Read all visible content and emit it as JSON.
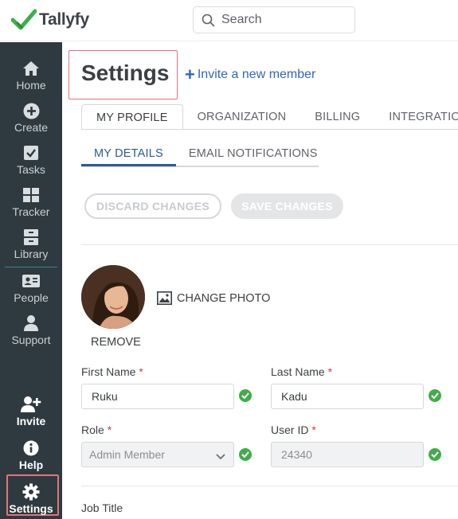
{
  "app": {
    "logo_text": "Tallyfy",
    "search_placeholder": "Search"
  },
  "sidebar": {
    "items": [
      {
        "label": "Home",
        "icon": "home-icon"
      },
      {
        "label": "Create",
        "icon": "plus-circle-icon"
      },
      {
        "label": "Tasks",
        "icon": "checkbox-icon"
      },
      {
        "label": "Tracker",
        "icon": "grid-icon"
      },
      {
        "label": "Library",
        "icon": "archive-icon"
      },
      {
        "label": "People",
        "icon": "id-card-icon"
      },
      {
        "label": "Support",
        "icon": "user-icon"
      }
    ],
    "bottom_items": [
      {
        "label": "Invite",
        "icon": "add-user-icon"
      },
      {
        "label": "Help",
        "icon": "info-icon"
      },
      {
        "label": "Settings",
        "icon": "gear-icon"
      }
    ]
  },
  "page": {
    "title": "Settings",
    "invite_link": "Invite a new member"
  },
  "tabs": [
    {
      "label": "MY PROFILE",
      "active": true
    },
    {
      "label": "ORGANIZATION",
      "active": false
    },
    {
      "label": "BILLING",
      "active": false
    },
    {
      "label": "INTEGRATIONS",
      "active": false
    }
  ],
  "subtabs": [
    {
      "label": "MY DETAILS",
      "active": true
    },
    {
      "label": "EMAIL NOTIFICATIONS",
      "active": false
    }
  ],
  "actions": {
    "discard_label": "DISCARD CHANGES",
    "save_label": "SAVE CHANGES"
  },
  "photo": {
    "change_label": "CHANGE PHOTO",
    "remove_label": "REMOVE"
  },
  "form": {
    "first_name": {
      "label": "First Name",
      "value": "Ruku",
      "required_mark": "*"
    },
    "last_name": {
      "label": "Last Name",
      "value": "Kadu",
      "required_mark": "*"
    },
    "role": {
      "label": "Role",
      "value": "Admin Member",
      "required_mark": "*"
    },
    "user_id": {
      "label": "User ID",
      "value": "24340",
      "required_mark": "*"
    },
    "job_title": {
      "label": "Job Title"
    }
  },
  "colors": {
    "sidebar_bg": "#2f3a40",
    "accent_blue": "#2a5a9c",
    "link_blue": "#3166c6",
    "highlight_red": "#e2737a",
    "success_green": "#3fae49",
    "logo_green": "#3fae49"
  }
}
